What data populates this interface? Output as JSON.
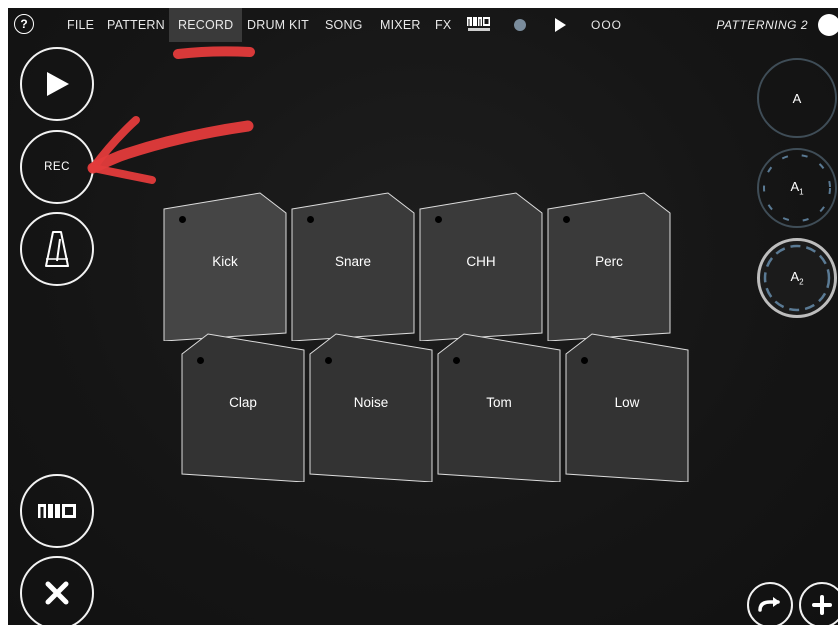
{
  "menubar": {
    "help_label": "?",
    "items": [
      "FILE",
      "PATTERN",
      "RECORD",
      "DRUM KIT",
      "SONG",
      "MIXER",
      "FX"
    ],
    "active_item": "RECORD",
    "midi_learn_icon": "midi-learn-icon",
    "counter": "OOO",
    "project_name": "PATTERNING 2"
  },
  "left_controls": {
    "rec_label": "REC",
    "midi_label": "MIDI"
  },
  "patterns": [
    "A",
    "A1",
    "A2"
  ],
  "pattern_labels": {
    "a": "A",
    "a1_main": "A",
    "a1_sub": "1",
    "a2_main": "A",
    "a2_sub": "2"
  },
  "pads": {
    "row1": [
      "Kick",
      "Snare",
      "CHH",
      "Perc"
    ],
    "row2": [
      "Clap",
      "Noise",
      "Tom",
      "Low"
    ]
  },
  "colors": {
    "background": "#151515",
    "pad_fill": "#383838",
    "pad_fill_light": "#4a4a4a",
    "status_dot": "#7a8c9c",
    "annotation": "#e33b3b",
    "active_menu": "#3a3a3a"
  },
  "icons": [
    "help-icon",
    "play-icon",
    "metronome-icon",
    "midi-icon",
    "close-icon",
    "redo-icon",
    "add-icon"
  ]
}
